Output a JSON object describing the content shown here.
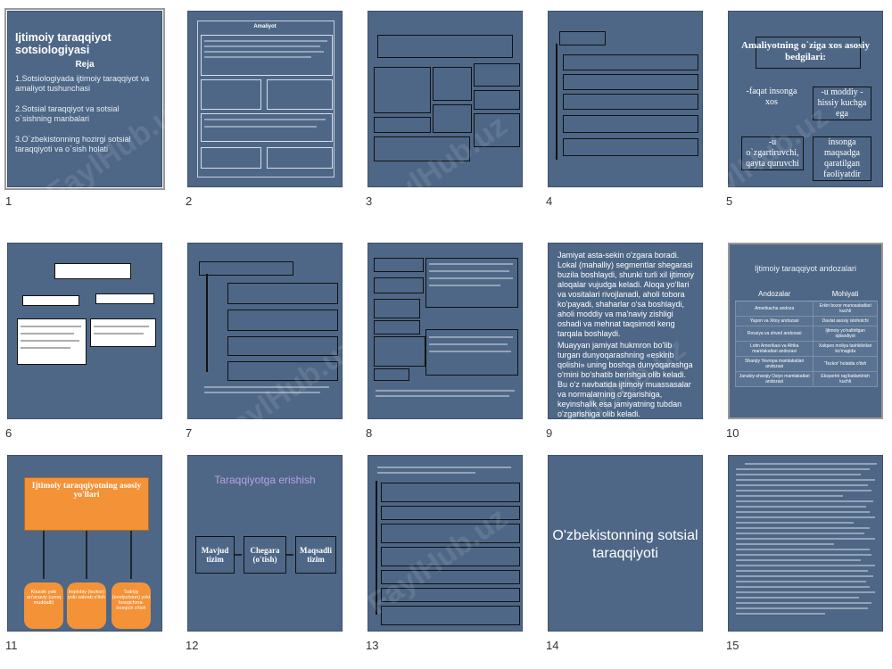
{
  "slides": [
    {
      "num": "1",
      "title": "Ijtimoiy taraqqiyot sotsiologiyasi",
      "reja": "Reja",
      "items": [
        "1.Sotsiologiyada ijtimoiy  taraqqiyot va amaliyot tushunchasi",
        "2.Sotsial taraqqiyot va sotsial o`sishning manbalari",
        "3.O`zbekistonning hozirgi sotsial taraqqiyoti va o`sish holati"
      ]
    },
    {
      "num": "2",
      "title": "Amaliyot"
    },
    {
      "num": "3"
    },
    {
      "num": "4"
    },
    {
      "num": "5",
      "title": "Amaliyotning o`ziga xos asosiy bedgilari:",
      "boxes": [
        "-faqat insonga xos",
        "-u moddiy - hissiy kuchga ega",
        "-u o`zgartiruvchi, qayta quruvchi",
        "insonga maqsadga qaratilgan faoliyatdir"
      ]
    },
    {
      "num": "6"
    },
    {
      "num": "7"
    },
    {
      "num": "8"
    },
    {
      "num": "9",
      "text": "Jamiyat asta-sekin o'zgara boradi. Lokal (mahalliy) segmentlar shegarasi buzila boshlaydi, shunki turli xil ijtimoiy aloqalar vujudga keladi. Aloqa yo'llari va vositalari rivojlanadi, aholi tobora ko'payadi, shaharlar o'sa boshlaydi, aholi moddiy va ma'naviy zishligi oshadi va mehnat taqsimoti keng tarqala boshlaydi.",
      "text2": "Muayyan jamiyat hukmron bo'lib turgan dunyoqarashning «eskirib qolishi» uning boshqa dunyoqarashga o'rnini bo'shatib berishga olib keladi. Bu o'z navbatida ijtimoiy muassasalar va normalarning o'zgarishiga, keyinshalik esa jamiyatning tubdan o'zgarishiga olib keladi."
    },
    {
      "num": "10",
      "title": "Ijtimoiy taraqqiyot andozalari",
      "col1": "Andozalar",
      "col2": "Mohiyati",
      "rows": [
        [
          "Amerikacha andoza",
          "Erkin bozor munosabatlari kuchli"
        ],
        [
          "Yapon va Xitoy andozasi",
          "Davlat asosiy islohotchi"
        ],
        [
          "Rossiya va shved andozasi",
          "Ijtimoiy yo'naltirilgan iqtisodiyot"
        ],
        [
          "Lotin Amerikasi va Afrika mamlakatlari andozasi",
          "Xalqaro moliya tashkilotlari ko'magida"
        ],
        [
          "Sharqiy Yevropa mamlakatlari andozasi",
          "'Tezkor' holatda o'tish"
        ],
        [
          "Janubiy-sharqiy Osiyo mamlakatlari andozasi",
          "Eksportni rag'batlantirish kuchli"
        ]
      ]
    },
    {
      "num": "11",
      "title": "Ijtimoiy taraqqiyotning asosiy yo'llari",
      "ovals": [
        "Klassik yoki an'anaviy (uzoq muddatli)",
        "Inqilobiy (tezkor) yoki sakrab o'tish",
        "Tadrijiy (evolyutsion) yoki bosqichma-bosqich o'tish"
      ]
    },
    {
      "num": "12",
      "title": "Taraqqiyotga erishish",
      "boxes": [
        "Mavjud tizim",
        "Chegara (o'tish)",
        "Maqsadli tizim"
      ]
    },
    {
      "num": "13"
    },
    {
      "num": "14",
      "title": "O'zbekistonning sotsial taraqqiyoti"
    },
    {
      "num": "15"
    }
  ],
  "watermark": "FaylHub.uz"
}
